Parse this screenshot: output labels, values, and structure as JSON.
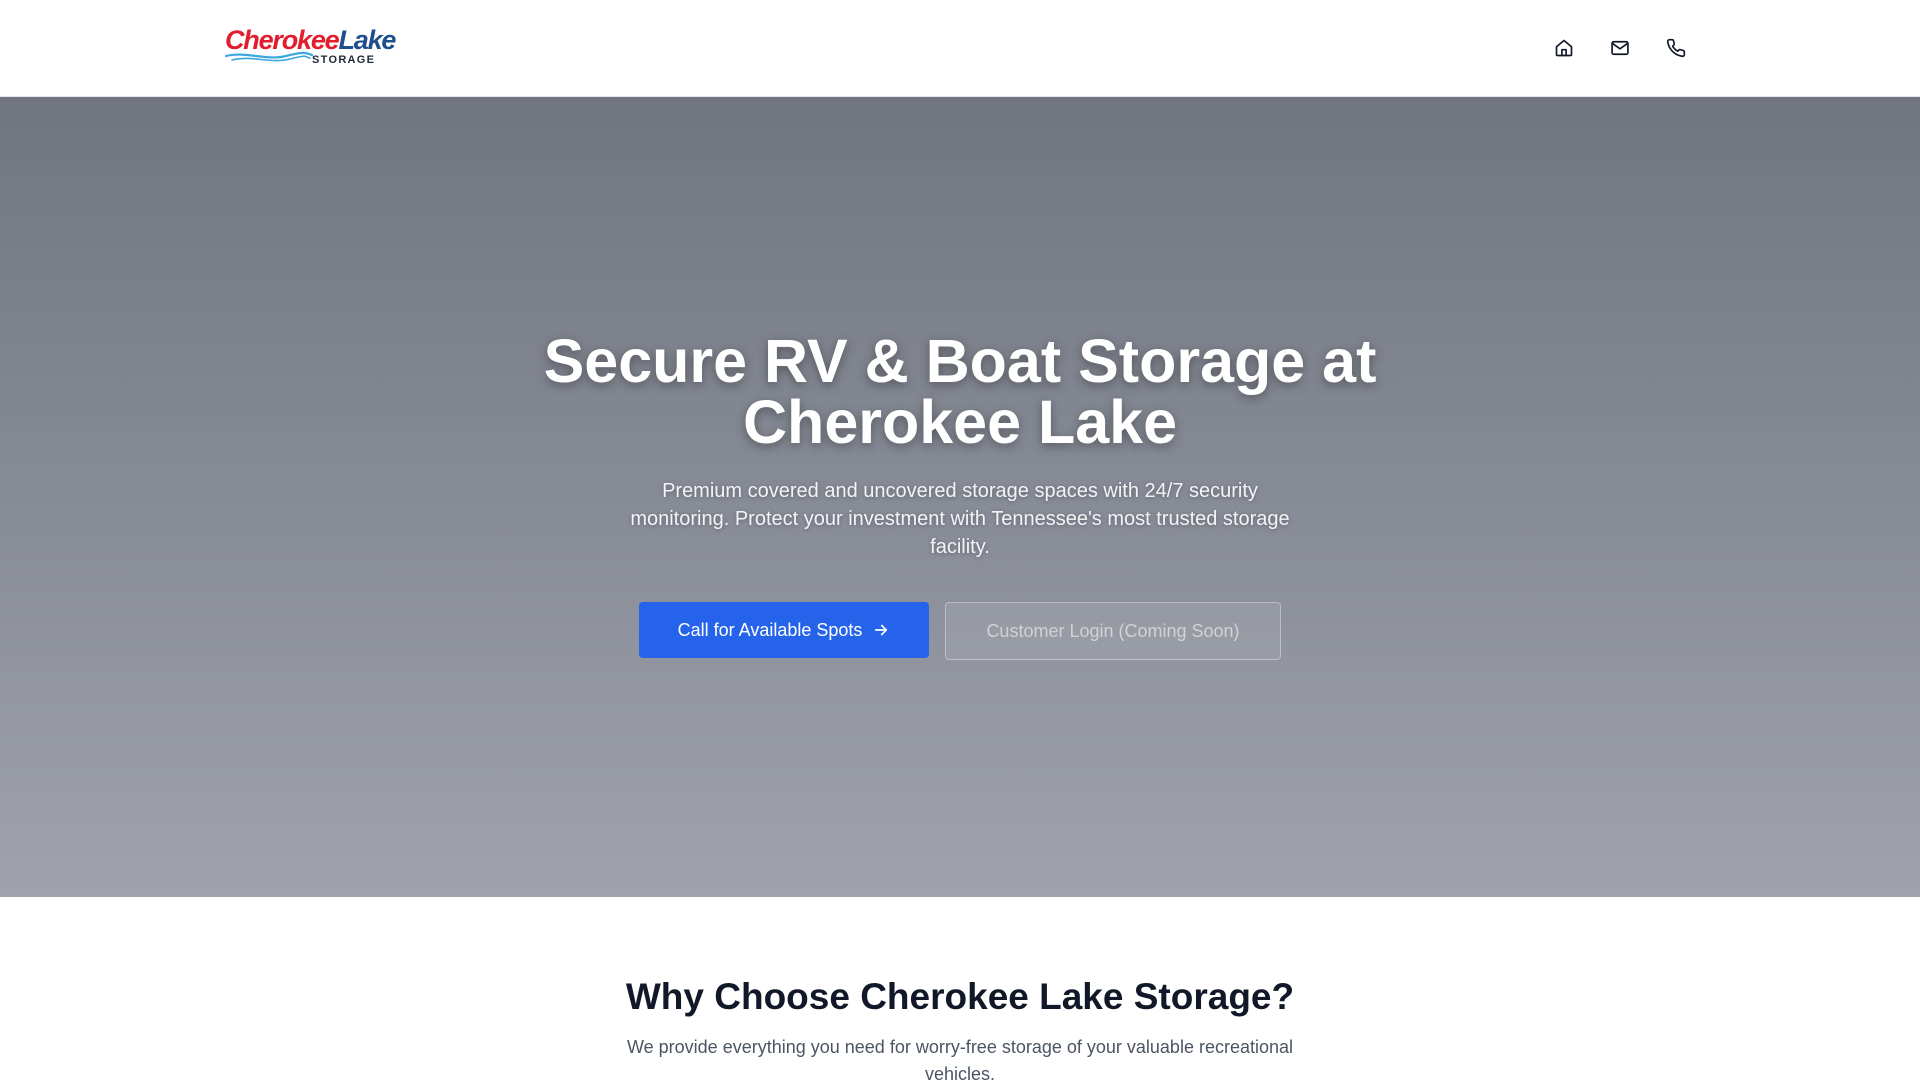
{
  "header": {
    "logo": {
      "word1": "Cherokee",
      "word2": "Lake",
      "sub": "STORAGE",
      "colors": {
        "cherokee": "#e11d2e",
        "lake": "#1e4f8c",
        "waves": "#3ba7de"
      }
    },
    "nav_icons": [
      "home-icon",
      "mail-icon",
      "phone-icon"
    ]
  },
  "hero": {
    "title": "Secure RV & Boat Storage at Cherokee Lake",
    "subtitle": "Premium covered and uncovered storage spaces with 24/7 security monitoring. Protect your investment with Tennessee's most trusted storage facility.",
    "primary_button": "Call for Available Spots",
    "primary_button_icon": "arrow-right-icon",
    "secondary_button": "Customer Login (Coming Soon)"
  },
  "features": {
    "title": "Why Choose Cherokee Lake Storage?",
    "subtitle": "We provide everything you need for worry-free storage of your valuable recreational vehicles."
  },
  "colors": {
    "accent": "#2563eb",
    "hero_top": "#71757f",
    "hero_bottom": "#a0a3ab",
    "heading": "#111827",
    "body_text": "#4b5563"
  }
}
